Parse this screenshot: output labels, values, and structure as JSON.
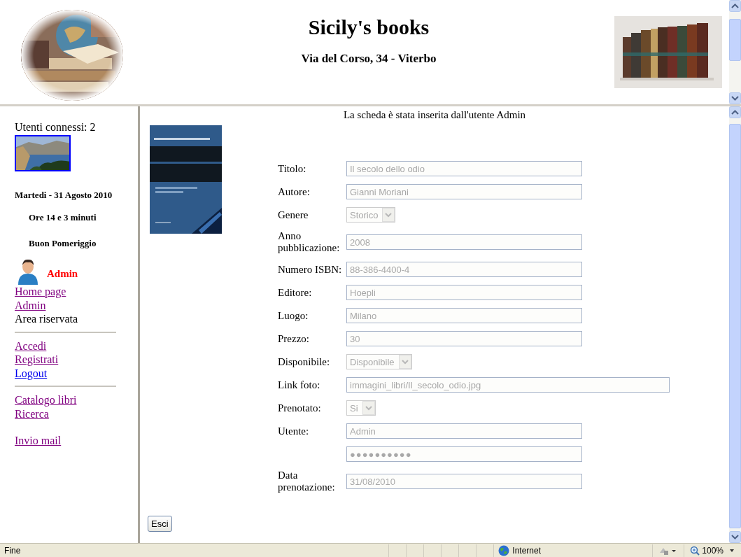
{
  "header": {
    "title": "Sicily's books",
    "address": "Via del Corso, 34 - Viterbo"
  },
  "sidebar": {
    "users_online": "Utenti connessi: 2",
    "date": "Martedi - 31 Agosto 2010",
    "time": "Ore 14 e 3 minuti",
    "greeting": "Buon Pomeriggio",
    "user": "Admin",
    "menu": [
      {
        "kind": "link",
        "label": "Home page",
        "visited": true
      },
      {
        "kind": "link",
        "label": "Admin",
        "visited": true
      },
      {
        "kind": "text",
        "label": "Area riservata"
      },
      {
        "kind": "rule"
      },
      {
        "kind": "link",
        "label": "Accedi",
        "visited": true
      },
      {
        "kind": "link",
        "label": "Registrati",
        "visited": true
      },
      {
        "kind": "link",
        "label": "Logout",
        "visited": false
      },
      {
        "kind": "rule"
      },
      {
        "kind": "link",
        "label": "Catalogo libri",
        "visited": true
      },
      {
        "kind": "link",
        "label": "Ricerca",
        "visited": true
      },
      {
        "kind": "space"
      },
      {
        "kind": "link",
        "label": "Invio mail",
        "visited": true
      }
    ]
  },
  "content": {
    "notice": "La scheda è stata inserita dall'utente Admin",
    "fields": [
      {
        "label": "Titolo:",
        "kind": "text",
        "value": "Il secolo dello odio",
        "disabled": true
      },
      {
        "label": "Autore:",
        "kind": "text",
        "value": "Gianni Moriani",
        "disabled": true
      },
      {
        "label": "Genere",
        "kind": "select",
        "value": "Storico",
        "disabled": true
      },
      {
        "label": "Anno pubblicazione:",
        "kind": "text",
        "value": "2008",
        "disabled": true
      },
      {
        "label": "Numero ISBN:",
        "kind": "text",
        "value": "88-386-4400-4",
        "disabled": true
      },
      {
        "label": "Editore:",
        "kind": "text",
        "value": "Hoepli",
        "disabled": true
      },
      {
        "label": "Luogo:",
        "kind": "text",
        "value": "Milano",
        "disabled": true
      },
      {
        "label": "Prezzo:",
        "kind": "text",
        "value": "30",
        "disabled": true
      },
      {
        "label": "Disponibile:",
        "kind": "select",
        "value": "Disponibile",
        "disabled": true
      },
      {
        "label": "Link foto:",
        "kind": "wide",
        "value": "immagini_libri/Il_secolo_odio.jpg",
        "disabled": true
      },
      {
        "label": "Prenotato:",
        "kind": "select",
        "value": "Si",
        "disabled": true
      },
      {
        "label": "Utente:",
        "kind": "text",
        "value": "Admin",
        "disabled": true
      },
      {
        "kind": "password",
        "value": "●●●●●●●●●●",
        "disabled": true
      },
      {
        "label": "Data prenotazione:",
        "kind": "text",
        "value": "31/08/2010",
        "disabled": true
      }
    ],
    "button": "Esci"
  },
  "status_bar": {
    "status": "Fine",
    "zone": "Internet",
    "zoom": "100%"
  }
}
